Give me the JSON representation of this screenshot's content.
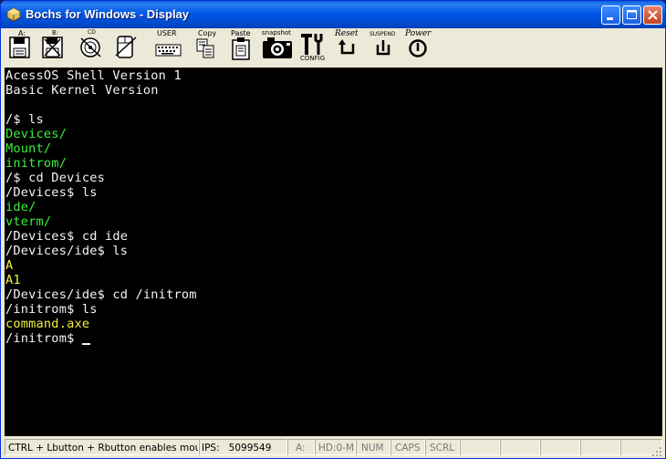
{
  "window": {
    "title": "Bochs for Windows - Display"
  },
  "toolbar": {
    "floppy_a": "A:",
    "floppy_b": "B:",
    "cdrom": "CD",
    "user": "USER",
    "copy": "Copy",
    "paste": "Paste",
    "snapshot": "snapshot",
    "config": "CONFIG",
    "reset": "Reset",
    "suspend": "SUSPEND",
    "power": "Power"
  },
  "terminal": {
    "lines": [
      {
        "text": "AcessOS Shell Version 1",
        "color": "#f4f4f4"
      },
      {
        "text": "Basic Kernel Version",
        "color": "#f4f4f4"
      },
      {
        "text": "",
        "color": "#f4f4f4"
      },
      {
        "text": "/$ ls",
        "color": "#f4f4f4"
      },
      {
        "text": "Devices/",
        "color": "#3cf03c"
      },
      {
        "text": "Mount/",
        "color": "#3cf03c"
      },
      {
        "text": "initrom/",
        "color": "#3cf03c"
      },
      {
        "text": "/$ cd Devices",
        "color": "#f4f4f4"
      },
      {
        "text": "/Devices$ ls",
        "color": "#f4f4f4"
      },
      {
        "text": "ide/",
        "color": "#3cf03c"
      },
      {
        "text": "vterm/",
        "color": "#3cf03c"
      },
      {
        "text": "/Devices$ cd ide",
        "color": "#f4f4f4"
      },
      {
        "text": "/Devices/ide$ ls",
        "color": "#f4f4f4"
      },
      {
        "text": "A",
        "color": "#f4f040"
      },
      {
        "text": "A1",
        "color": "#f4f040"
      },
      {
        "text": "/Devices/ide$ cd /initrom",
        "color": "#f4f4f4"
      },
      {
        "text": "/initrom$ ls",
        "color": "#f4f4f4"
      },
      {
        "text": "command.axe",
        "color": "#f4f040"
      },
      {
        "text": "/initrom$ ",
        "color": "#f4f4f4"
      }
    ]
  },
  "status": {
    "message": "CTRL + Lbutton + Rbutton enables mouse",
    "ips_label": "IPS:",
    "ips_value": "5099549",
    "drive_a": "A:",
    "drive_hd": "HD:0-M",
    "num": "NUM",
    "caps": "CAPS",
    "scrl": "SCRL"
  },
  "icons": [
    "bochs-app-icon",
    "minimize-icon",
    "maximize-icon",
    "close-icon",
    "floppy-a-icon",
    "floppy-b-icon",
    "cdrom-icon",
    "mouse-icon",
    "user-keyboard-icon",
    "copy-icon",
    "paste-icon",
    "snapshot-camera-icon",
    "config-icon",
    "reset-icon",
    "suspend-icon",
    "power-icon"
  ]
}
